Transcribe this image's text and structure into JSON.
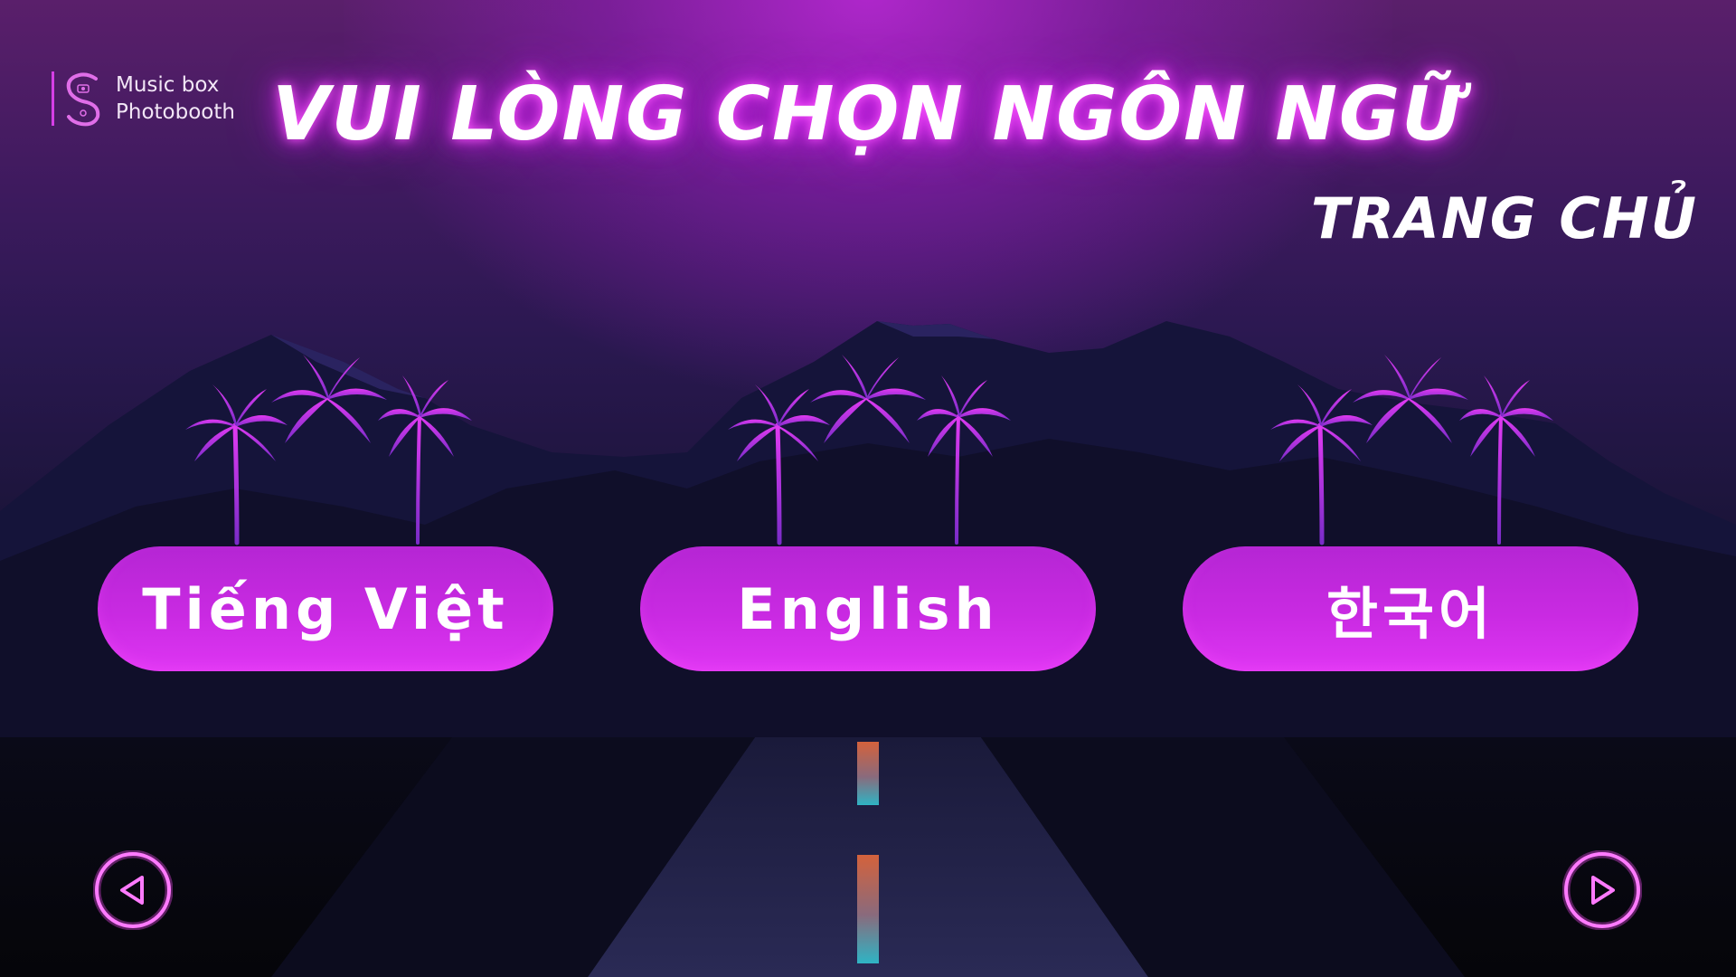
{
  "app": {
    "logo_line1": "Music box",
    "logo_line2": "Photobooth"
  },
  "header": {
    "title": "VUI LÒNG CHỌN NGÔN NGỮ",
    "home_link": "TRANG CHỦ"
  },
  "languages": [
    {
      "label": "Tiếng Việt"
    },
    {
      "label": "English"
    },
    {
      "label": "한국어"
    }
  ],
  "navigation": {
    "prev_icon": "triangle-left-icon",
    "next_icon": "triangle-right-icon"
  },
  "colors": {
    "accent": "#d92ef0",
    "button": "#c92ae2",
    "neon_glow": "#ff4dff",
    "mountain": "#15143a",
    "road_stripe_top": "#d4623c",
    "road_stripe_bottom": "#2fb4c4"
  }
}
